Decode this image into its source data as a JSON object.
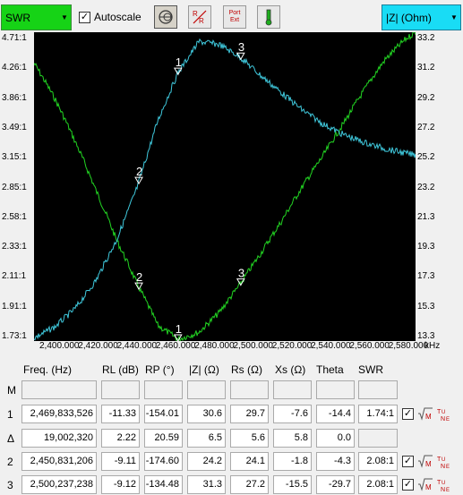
{
  "toolbar": {
    "left_select": "SWR",
    "autoscale_label": "Autoscale",
    "autoscale_checked": true,
    "right_select": "|Z| (Ohm)",
    "port_ext_label": "Port Ext"
  },
  "chart": {
    "y_left_ticks": [
      "4.71:1",
      "4.26:1",
      "3.86:1",
      "3.49:1",
      "3.15:1",
      "2.85:1",
      "2.58:1",
      "2.33:1",
      "2.11:1",
      "1.91:1",
      "1.73:1"
    ],
    "y_right_ticks": [
      "33.2",
      "31.2",
      "29.2",
      "27.2",
      "25.2",
      "23.2",
      "21.3",
      "19.3",
      "17.3",
      "15.3",
      "13.3"
    ],
    "x_ticks": [
      "2,400.000",
      "2,420.000",
      "2,440.000",
      "2,460.000",
      "2,480.000",
      "2,500.000",
      "2,520.000",
      "2,540.000",
      "2,560.000",
      "2,580.000"
    ],
    "x_unit": "kHz"
  },
  "chart_data": {
    "type": "line",
    "x_range_khz": [
      2400000,
      2585000
    ],
    "y_left_label": "SWR",
    "y_left_range": [
      1.73,
      4.71
    ],
    "y_left_scale": "log",
    "y_right_label": "|Z| (Ohm)",
    "y_right_range": [
      13.3,
      33.2
    ],
    "background": "#000000",
    "grid": false,
    "series": [
      {
        "name": "SWR",
        "color": "#22d322",
        "axis": "left",
        "x_khz": [
          2400000,
          2410000,
          2420000,
          2430000,
          2440000,
          2450000,
          2460000,
          2469834,
          2480000,
          2490000,
          2500000,
          2510000,
          2520000,
          2530000,
          2540000,
          2550000,
          2560000,
          2570000,
          2580000,
          2585000
        ],
        "y": [
          4.26,
          3.8,
          3.3,
          2.82,
          2.4,
          2.08,
          1.82,
          1.74,
          1.78,
          1.9,
          2.08,
          2.3,
          2.55,
          2.85,
          3.15,
          3.5,
          3.9,
          4.3,
          4.6,
          4.71
        ]
      },
      {
        "name": "|Z| (Ohm)",
        "color": "#3fc8dc",
        "axis": "right",
        "x_khz": [
          2400000,
          2410000,
          2420000,
          2430000,
          2440000,
          2450000,
          2460000,
          2469834,
          2480000,
          2490000,
          2500000,
          2510000,
          2520000,
          2530000,
          2540000,
          2550000,
          2560000,
          2570000,
          2580000,
          2585000
        ],
        "y": [
          13.5,
          14.2,
          15.4,
          17.2,
          19.8,
          23.2,
          27.5,
          30.6,
          32.6,
          32.4,
          31.6,
          30.4,
          29.3,
          28.2,
          27.3,
          26.6,
          26.1,
          25.7,
          25.4,
          25.3
        ]
      }
    ],
    "markers": [
      {
        "label": "1",
        "x_khz": 2469834
      },
      {
        "label": "2",
        "x_khz": 2450831
      },
      {
        "label": "3",
        "x_khz": 2500237
      }
    ]
  },
  "table": {
    "headers": [
      "Freq. (Hz)",
      "RL (dB)",
      "RP (°)",
      "|Z| (Ω)",
      "Rs (Ω)",
      "Xs (Ω)",
      "Theta",
      "SWR"
    ],
    "rows": [
      {
        "label": "M",
        "cells": [
          "",
          "",
          "",
          "",
          "",
          "",
          "",
          ""
        ],
        "checkbox": false
      },
      {
        "label": "1",
        "cells": [
          "2,469,833,526",
          "-11.33",
          "-154.01",
          "30.6",
          "29.7",
          "-7.6",
          "-14.4",
          "1.74:1"
        ],
        "checkbox": true
      },
      {
        "label": "Δ",
        "cells": [
          "19,002,320",
          "2.22",
          "20.59",
          "6.5",
          "5.6",
          "5.8",
          "0.0",
          ""
        ],
        "checkbox": false
      },
      {
        "label": "2",
        "cells": [
          "2,450,831,206",
          "-9.11",
          "-174.60",
          "24.2",
          "24.1",
          "-1.8",
          "-4.3",
          "2.08:1"
        ],
        "checkbox": true
      },
      {
        "label": "3",
        "cells": [
          "2,500,237,238",
          "-9.12",
          "-134.48",
          "31.3",
          "27.2",
          "-15.5",
          "-29.7",
          "2.08:1"
        ],
        "checkbox": true
      }
    ]
  }
}
